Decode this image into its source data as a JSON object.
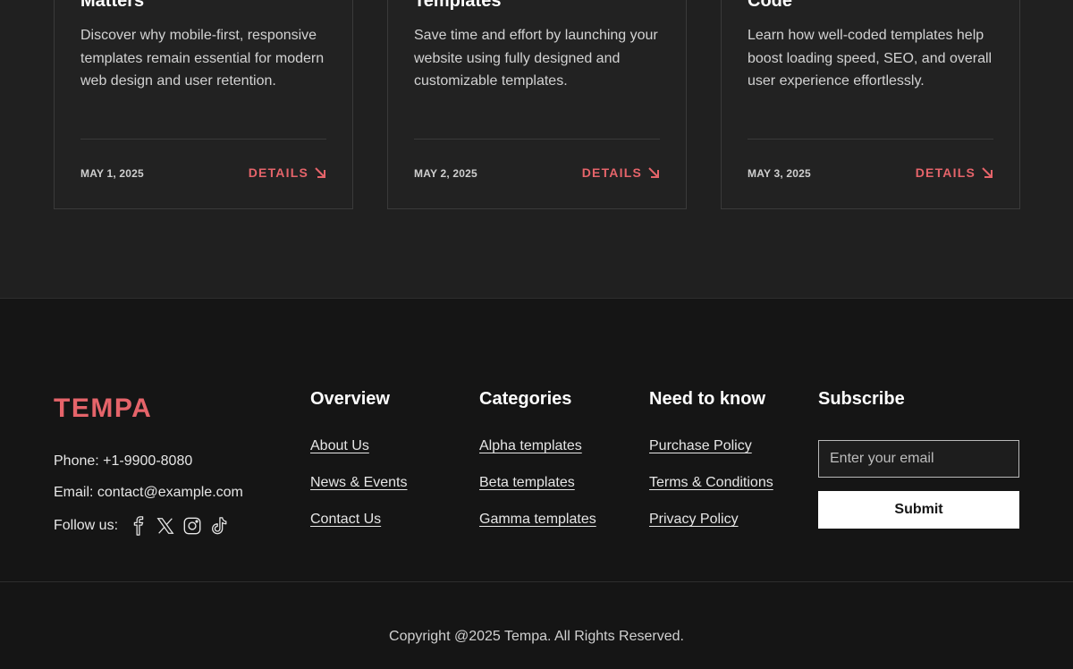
{
  "cards": [
    {
      "title": "Matters",
      "text": "Discover why mobile-first, responsive templates remain essential for modern web design and user retention.",
      "date": "MAY 1, 2025",
      "link_label": "DETAILS"
    },
    {
      "title": "Templates",
      "text": "Save time and effort by launching your website using fully designed and customizable templates.",
      "date": "MAY 2, 2025",
      "link_label": "DETAILS"
    },
    {
      "title": "Code",
      "text": "Learn how well-coded templates help boost loading speed, SEO, and overall user experience effortlessly.",
      "date": "MAY 3, 2025",
      "link_label": "DETAILS"
    }
  ],
  "footer": {
    "logo": "TEMPA",
    "phone": "Phone: +1-9900-8080",
    "email": "Email: contact@example.com",
    "follow_label": "Follow us:",
    "social_icons": [
      "facebook-icon",
      "x-icon",
      "instagram-icon",
      "tiktok-icon"
    ],
    "columns": {
      "overview": {
        "heading": "Overview",
        "links": [
          "About  Us",
          "News & Events",
          "Contact Us"
        ]
      },
      "categories": {
        "heading": "Categories",
        "links": [
          "Alpha templates",
          "Beta templates",
          "Gamma templates"
        ]
      },
      "need_to_know": {
        "heading": "Need to know",
        "links": [
          "Purchase Policy",
          "Terms & Conditions",
          "Privacy Policy"
        ]
      }
    },
    "subscribe": {
      "heading": "Subscribe",
      "placeholder": "Enter your email",
      "button_label": "Submit"
    },
    "copyright": "Copyright @2025 Tempa. All Rights Reserved."
  },
  "colors": {
    "accent": "#e5646a",
    "page_bg": "#151515",
    "card_section_bg": "#202020"
  }
}
